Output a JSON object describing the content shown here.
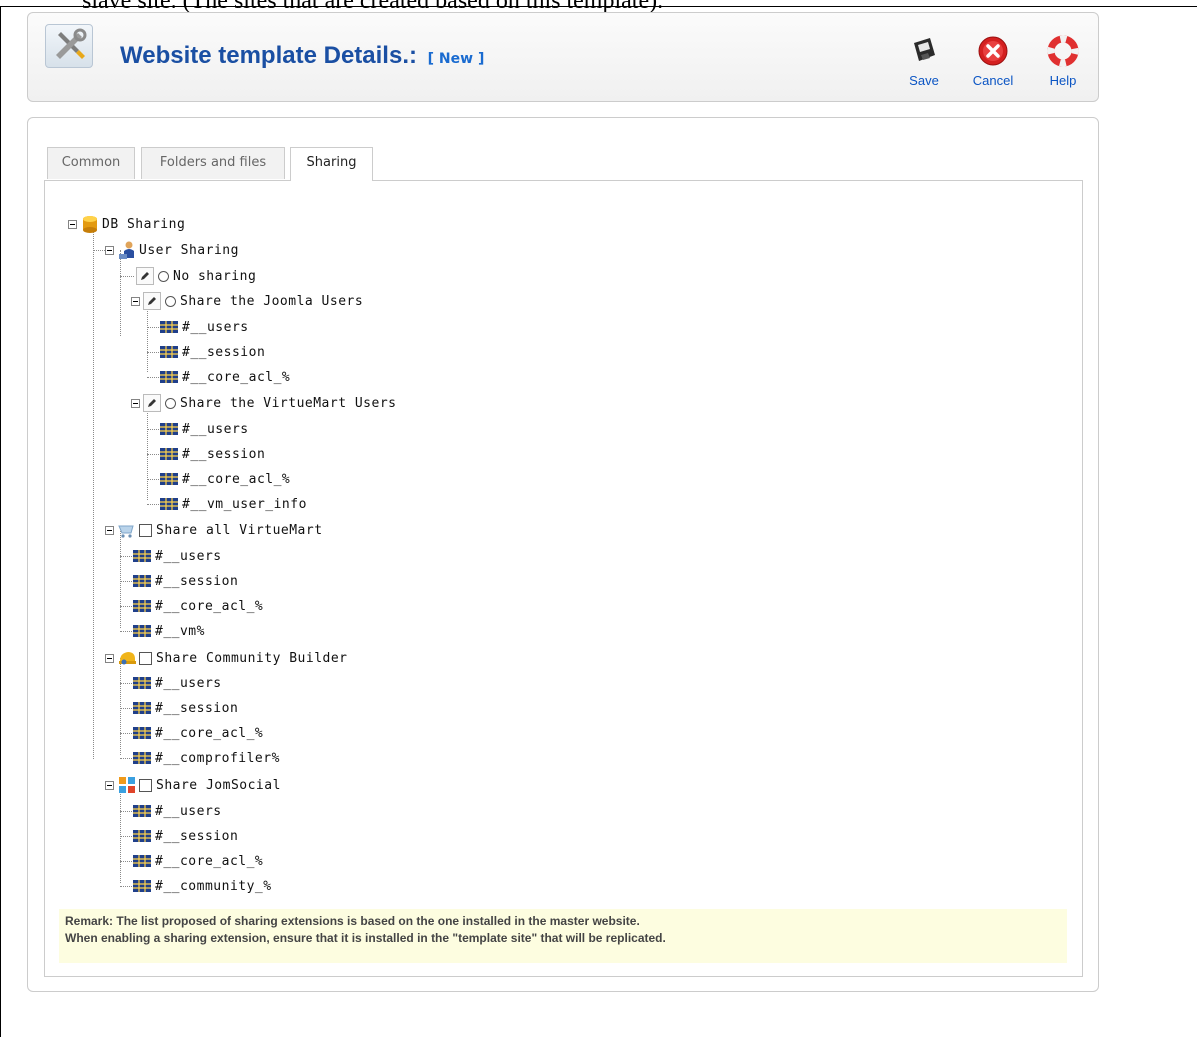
{
  "document": {
    "top_text": "slave site. (The sites that are created based on this template)."
  },
  "header": {
    "title": "Website template Details.:",
    "status_tag": "[ New ]"
  },
  "toolbar": {
    "save_label": "Save",
    "cancel_label": "Cancel",
    "help_label": "Help"
  },
  "tabs": [
    {
      "label": "Common"
    },
    {
      "label": "Folders and files"
    },
    {
      "label": "Sharing"
    }
  ],
  "active_tab": "Sharing",
  "tree": {
    "root": "DB Sharing",
    "user_sharing": {
      "label": "User Sharing",
      "no_sharing": "No sharing",
      "joomla": {
        "label": "Share the Joomla Users",
        "tables": [
          "#__users",
          "#__session",
          "#__core_acl_%"
        ]
      },
      "virtuemart_users": {
        "label": "Share the VirtueMart Users",
        "tables": [
          "#__users",
          "#__session",
          "#__core_acl_%",
          "#__vm_user_info"
        ]
      }
    },
    "virtuemart": {
      "label": "Share all VirtueMart",
      "tables": [
        "#__users",
        "#__session",
        "#__core_acl_%",
        "#__vm%"
      ]
    },
    "community_builder": {
      "label": "Share Community Builder",
      "tables": [
        "#__users",
        "#__session",
        "#__core_acl_%",
        "#__comprofiler%"
      ]
    },
    "jomsocial": {
      "label": "Share JomSocial",
      "tables": [
        "#__users",
        "#__session",
        "#__core_acl_%",
        "#__community_%"
      ]
    }
  },
  "remark": {
    "line1": "Remark: The list proposed of sharing extensions is based on the one installed in the master website.",
    "line2": "When enabling a sharing extension, ensure that it is installed in the \"template site\" that will be replicated."
  },
  "colors": {
    "title": "#1a4fa3",
    "toolbar_label": "#0b55c4",
    "remark_bg": "#fdfde0",
    "cancel_red": "#d42020"
  },
  "icons": {
    "header": "tools-icon",
    "save": "floppy-disk-icon",
    "cancel": "cancel-icon",
    "help": "lifebuoy-icon",
    "db": "database-icon",
    "user": "user-icon",
    "table": "table-icon",
    "edit": "pencil-icon",
    "cart": "shopping-cart-icon",
    "community": "community-builder-icon",
    "jomsocial": "jomsocial-icon"
  }
}
